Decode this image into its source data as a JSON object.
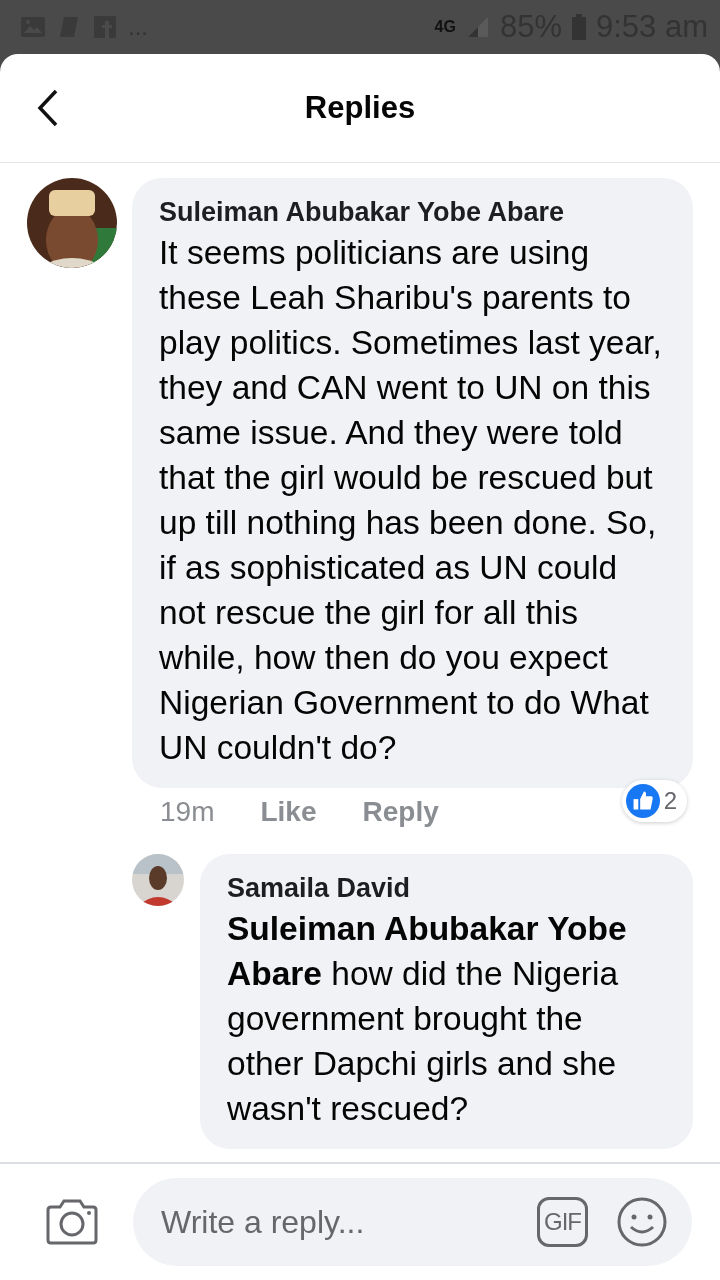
{
  "status_bar": {
    "overflow": "...",
    "network": "4G",
    "battery": "85%",
    "time": "9:53 am"
  },
  "header": {
    "title": "Replies"
  },
  "comments": [
    {
      "author": "Suleiman Abubakar Yobe Abare",
      "text": "It seems politicians are using these Leah Sharibu's parents to play politics. Sometimes last year, they and CAN went to UN on this same issue. And they were told that the girl would be rescued but up till nothing has been done. So, if as sophisticated as UN could not rescue the girl for all this while, how then do you expect Nigerian Government to do What UN couldn't do?",
      "time": "19m",
      "actions": [
        "Like",
        "Reply"
      ],
      "reaction_count": "2",
      "replies": [
        {
          "author": "Samaila David",
          "text": "**Suleiman Abubakar Yobe Abare** how did the Nigeria government brought the other Dapchi girls and she wasn't rescued?"
        }
      ]
    }
  ],
  "composer": {
    "placeholder": "Write a reply...",
    "gif": "GIF"
  }
}
